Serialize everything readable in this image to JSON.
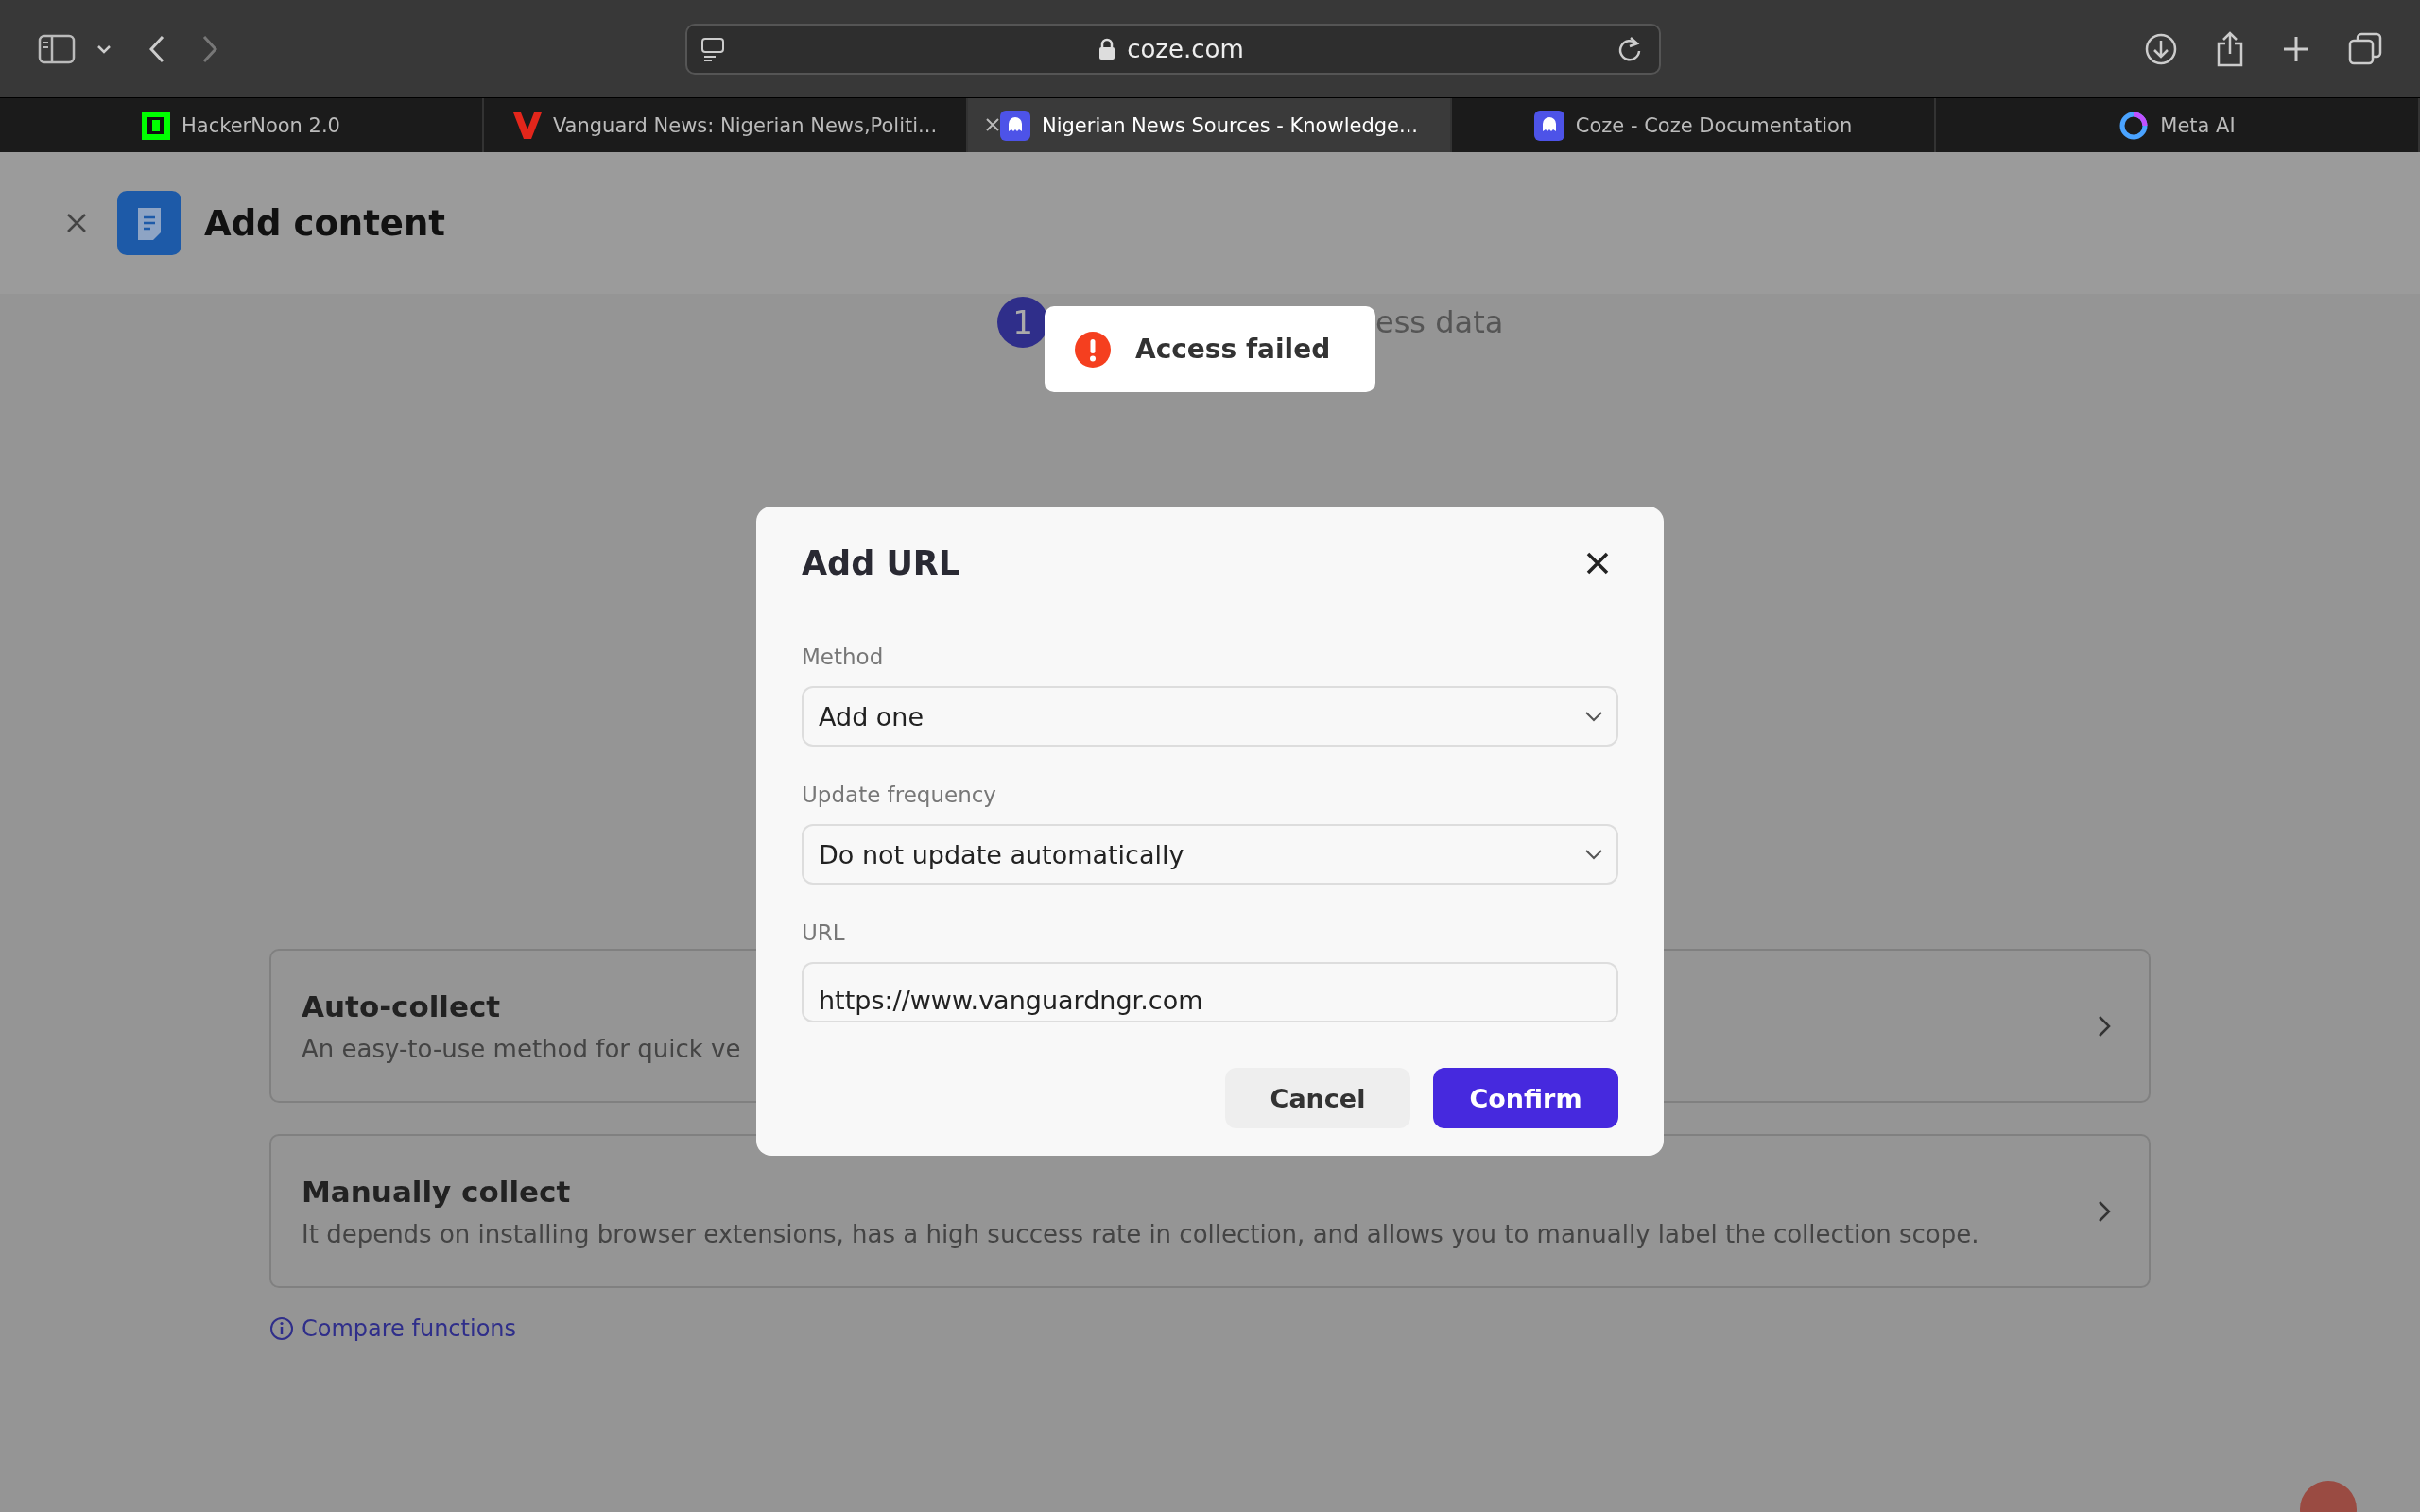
{
  "browser": {
    "url": "coze.com",
    "tabs": [
      {
        "title": "HackerNoon 2.0",
        "kind": "hackernoon",
        "selected": false
      },
      {
        "title": "Vanguard News: Nigerian News,Politi...",
        "kind": "vanguard",
        "selected": false
      },
      {
        "title": "Nigerian News Sources - Knowledge...",
        "kind": "coze",
        "selected": true
      },
      {
        "title": "Coze - Coze Documentation",
        "kind": "coze",
        "selected": false
      },
      {
        "title": "Meta AI",
        "kind": "meta",
        "selected": false
      }
    ]
  },
  "page": {
    "title": "Add content",
    "step": {
      "number": "1",
      "label": "ess data"
    },
    "options": [
      {
        "title": "Auto-collect",
        "description": "An easy-to-use method for quick ve"
      },
      {
        "title": "Manually collect",
        "description": "It depends on installing browser extensions, has a high success rate in collection, and allows you to manually label the collection scope."
      }
    ],
    "compare_link": "Compare functions"
  },
  "dialog": {
    "title": "Add URL",
    "fields": [
      {
        "label": "Method",
        "kind": "select",
        "value": "Add one"
      },
      {
        "label": "Update frequency",
        "kind": "select",
        "value": "Do not update automatically"
      },
      {
        "label": "URL",
        "kind": "input",
        "value": "https://www.vanguardngr.com"
      }
    ],
    "buttons": [
      {
        "label": "Cancel",
        "kind": "secondary"
      },
      {
        "label": "Confirm",
        "kind": "primary"
      }
    ]
  },
  "toast": {
    "message": "Access failed",
    "kind": "error"
  }
}
